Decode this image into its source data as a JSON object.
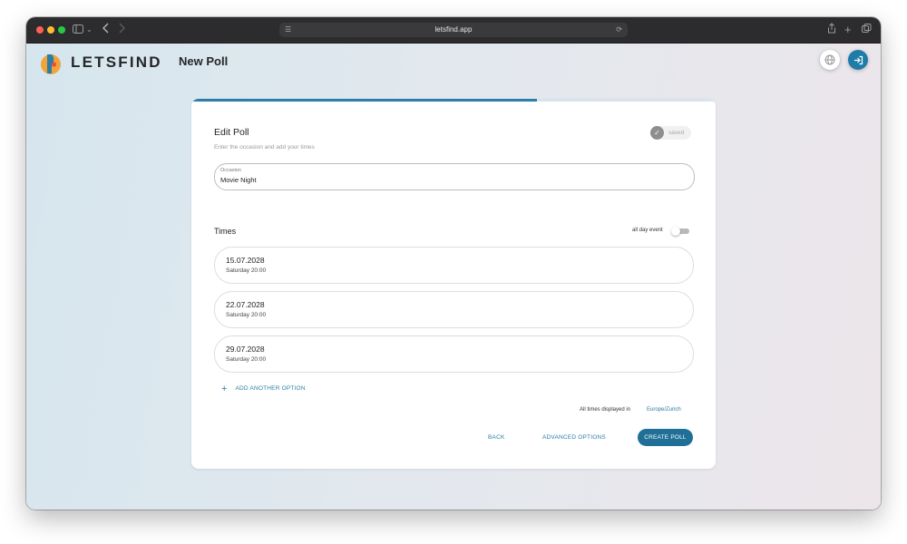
{
  "browser": {
    "url": "letsfind.app",
    "traffic_light_colors": [
      "#ff5f57",
      "#febc2e",
      "#28c840"
    ]
  },
  "header": {
    "brand": "LETSFIND",
    "page_title": "New Poll",
    "brand_colors": [
      "#2c7da8",
      "#f2a33a",
      "#e94e3d"
    ]
  },
  "card": {
    "progress_fraction": 0.66,
    "title": "Edit Poll",
    "subtitle": "Enter the occasion and add your times",
    "saved_label": "saved",
    "occasion": {
      "label": "Occasion",
      "value": "Movie Night"
    },
    "times": {
      "title": "Times",
      "all_day_label": "all day event",
      "all_day_enabled": false,
      "items": [
        {
          "date": "15.07.2028",
          "detail": "Saturday 20:00"
        },
        {
          "date": "22.07.2028",
          "detail": "Saturday 20:00"
        },
        {
          "date": "29.07.2028",
          "detail": "Saturday 20:00"
        }
      ],
      "add_option_label": "ADD ANOTHER OPTION"
    },
    "timezone": {
      "note": "All times displayed in",
      "zone": "Europe/Zurich"
    },
    "actions": {
      "back": "BACK",
      "advanced": "ADVANCED OPTIONS",
      "create": "CREATE POLL"
    }
  },
  "colors": {
    "accent": "#2c7da8",
    "primary_button": "#1f6f97"
  }
}
